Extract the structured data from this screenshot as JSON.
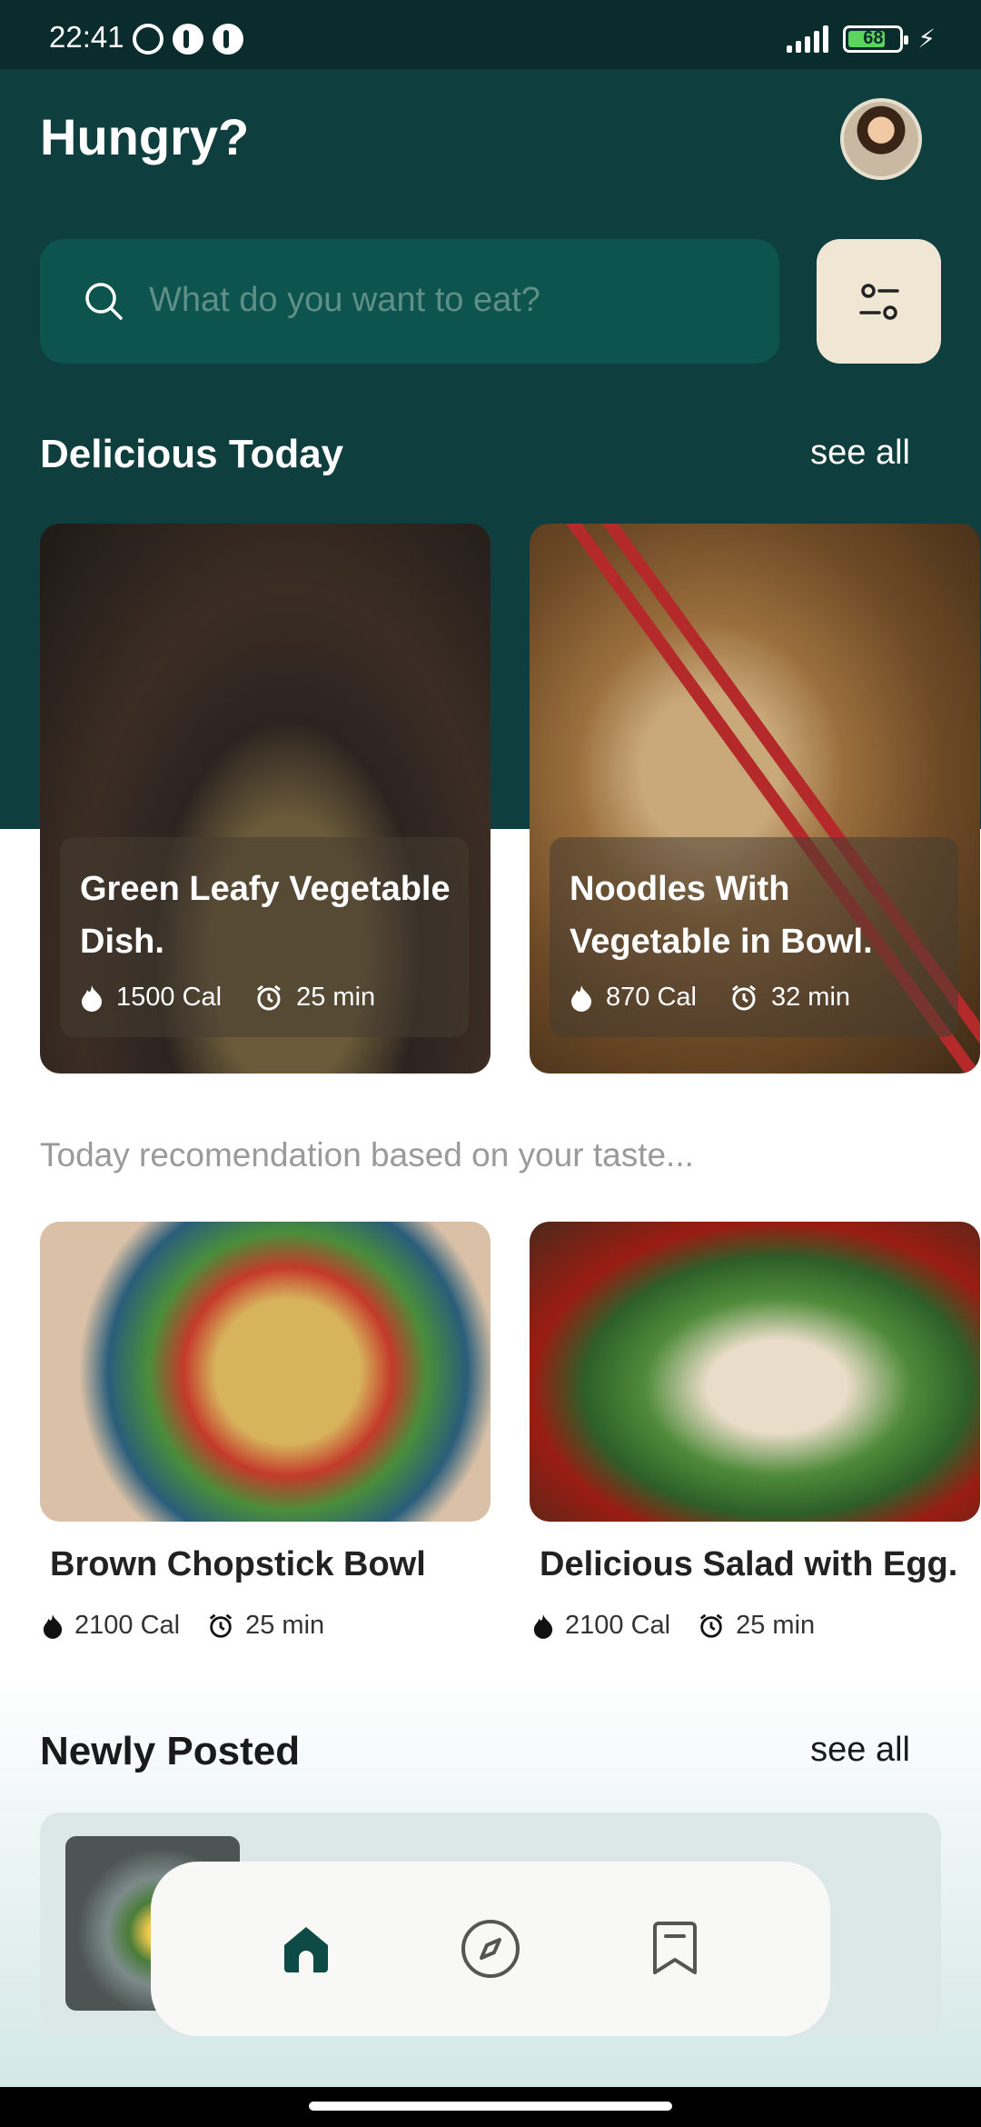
{
  "status": {
    "time": "22:41",
    "battery": "68",
    "icons": [
      "alarm-icon",
      "app-icon",
      "app-icon",
      "signal-icon",
      "battery-icon",
      "charging-icon"
    ]
  },
  "header": {
    "title": "Hungry?"
  },
  "search": {
    "placeholder": "What do you want to eat?"
  },
  "delicious": {
    "title": "Delicious Today",
    "see_all": "see all",
    "cards": [
      {
        "title": "Green Leafy Vegetable Dish.",
        "cal": "1500 Cal",
        "time": "25 min"
      },
      {
        "title": "Noodles With Vegetable in Bowl.",
        "cal": "870 Cal",
        "time": "32 min"
      }
    ]
  },
  "recommendation": {
    "label": "Today recomendation based on your taste...",
    "items": [
      {
        "title": "Brown Chopstick Bowl",
        "cal": "2100 Cal",
        "time": "25 min"
      },
      {
        "title": "Delicious Salad with Egg.",
        "cal": "2100 Cal",
        "time": "25 min"
      }
    ]
  },
  "newly": {
    "title": "Newly Posted",
    "see_all": "see all"
  },
  "nav": {
    "items": [
      "home-icon",
      "compass-icon",
      "bookmark-icon"
    ]
  },
  "colors": {
    "primary": "#0e3f3e",
    "accent": "#efe7d4",
    "search_bg": "#0c544d"
  }
}
